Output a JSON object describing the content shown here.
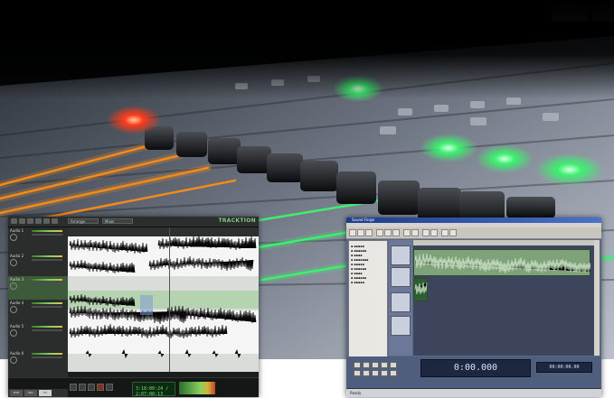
{
  "photo": {
    "subject": "audio mixing console",
    "colors": {
      "fader_led_orange": "#f28b1c",
      "fader_led_green": "#3df06e",
      "button_red": "#ff3a1a",
      "panel": "#8f96a2"
    }
  },
  "left_window": {
    "logo": "TRACKTION",
    "toolbar_dropdowns": [
      "Arrange",
      "Mixer"
    ],
    "tracks": [
      {
        "name": "Audio 1"
      },
      {
        "name": "Audio 2"
      },
      {
        "name": "Audio 3"
      },
      {
        "name": "Audio 4"
      },
      {
        "name": "Audio 5"
      },
      {
        "name": "Audio 6"
      }
    ],
    "lcd_readout": "3:18:00:24 / 2:07:00:13",
    "bottom_tabs": [
      "Edit",
      "Mix",
      "Fx"
    ],
    "colors": {
      "waveform": "#111111",
      "lane_highlight": "#b5d3b0",
      "meter": "#8bd05d"
    }
  },
  "right_window": {
    "title": "Sound Forge",
    "timecode": "0:00.000",
    "small_counter": "00:00:00.00",
    "status_text": "Ready",
    "colors": {
      "clip": "#7fa27a",
      "clip_selected": "#2f5e36",
      "background": "#5a6a86"
    }
  }
}
